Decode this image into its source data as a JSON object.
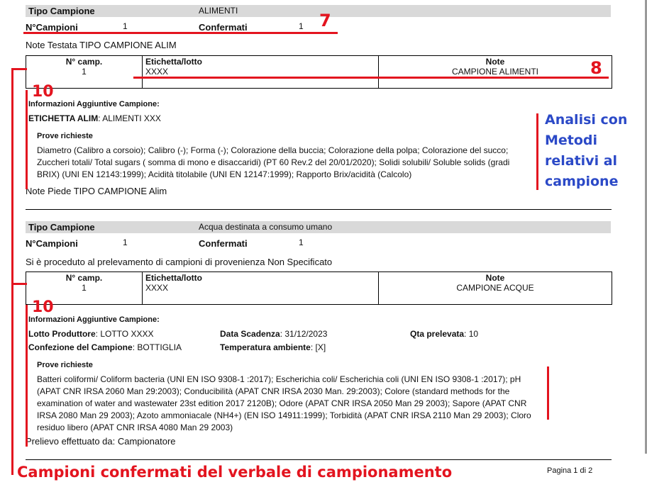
{
  "section1": {
    "tipo_label": "Tipo Campione",
    "tipo_value": "ALIMENTI",
    "ncamp_label": "N°Campioni",
    "ncamp_value": "1",
    "conf_label": "Confermati",
    "conf_value": "1",
    "note_testata": "Note Testata TIPO CAMPIONE ALIM",
    "table": {
      "col1_header": "N° camp.",
      "col1_value": "1",
      "col2_header": "Etichetta/lotto",
      "col2_value": "XXXX",
      "col3_header": "Note",
      "col3_value": "CAMPIONE ALIMENTI"
    },
    "info_title": "Informazioni Aggiuntive Campione:",
    "info_key": "ETICHETTA ALIM",
    "info_value": ": ALIMENTI XXX",
    "prove_title": "Prove richieste",
    "prove_lines": [
      "Diametro (Calibro a corsoio); Calibro (-); Forma (-); Colorazione della buccia; Colorazione della polpa; Colorazione del succo;",
      "Zuccheri totali/ Total sugars ( somma di mono e disaccaridi) (PT 60 Rev.2 del 20/01/2020); Solidi solubili/ Soluble solids (gradi",
      "BRIX) (UNI EN 12143:1999); Acidità titolabile (UNI EN 12147:1999); Rapporto Brix/acidità (Calcolo)"
    ],
    "note_piede": "Note Piede TIPO CAMPIONE Alim"
  },
  "section2": {
    "tipo_label": "Tipo Campione",
    "tipo_value": "Acqua destinata a consumo umano",
    "ncamp_label": "N°Campioni",
    "ncamp_value": "1",
    "conf_label": "Confermati",
    "conf_value": "1",
    "note_testata": "Si è proceduto al prelevamento di campioni di provenienza Non Specificato",
    "table": {
      "col1_header": "N° camp.",
      "col1_value": "1",
      "col2_header": "Etichetta/lotto",
      "col2_value": "XXXX",
      "col3_header": "Note",
      "col3_value": "CAMPIONE ACQUE"
    },
    "info_title": "Informazioni Aggiuntive Campione:",
    "lotto_key": "Lotto Produttore",
    "lotto_value": ": LOTTO XXXX",
    "scad_key": "Data Scadenza",
    "scad_value": ": 31/12/2023",
    "qta_key": "Qta prelevata",
    "qta_value": ": 10",
    "conf_camp_key": "Confezione del Campione",
    "conf_camp_value": ": BOTTIGLIA",
    "temp_key": "Temperatura ambiente",
    "temp_value": ": [X]",
    "prove_title": "Prove richieste",
    "prove_lines": [
      "Batteri coliformi/ Coliform bacteria (UNI EN ISO 9308-1 :2017); Escherichia coli/ Escherichia coli (UNI EN ISO 9308-1 :2017); pH",
      "(APAT CNR IRSA 2060 Man 29:2003); Conducibilità (APAT CNR IRSA 2030 Man. 29:2003); Colore (standard methods for the",
      "examination of water and wastewater 23st edition 2017 2120B); Odore (APAT CNR IRSA 2050 Man 29 2003); Sapore (APAT CNR",
      "IRSA 2080 Man 29 2003); Azoto ammoniacale (NH4+) (EN ISO 14911:1999); Torbidità (APAT CNR IRSA 2110 Man 29 2003); Cloro",
      "residuo libero (APAT CNR IRSA 4080 Man 29 2003)"
    ],
    "prelievo": "Prelievo effettuato da: Campionatore"
  },
  "annotations": {
    "n7": "7",
    "n8": "8",
    "n10a": "10",
    "n10b": "10",
    "analisi_lines": [
      "Analisi con",
      "Metodi",
      "relativi al",
      "campione"
    ],
    "bottom_caption": "Campioni confermati del verbale di campionamento"
  },
  "footer": {
    "page": "Pagina 1 di 2"
  },
  "colors": {
    "annotation_red": "#e3141f",
    "annotation_blue": "#2b49c7",
    "header_bar": "#d9d9d9"
  }
}
